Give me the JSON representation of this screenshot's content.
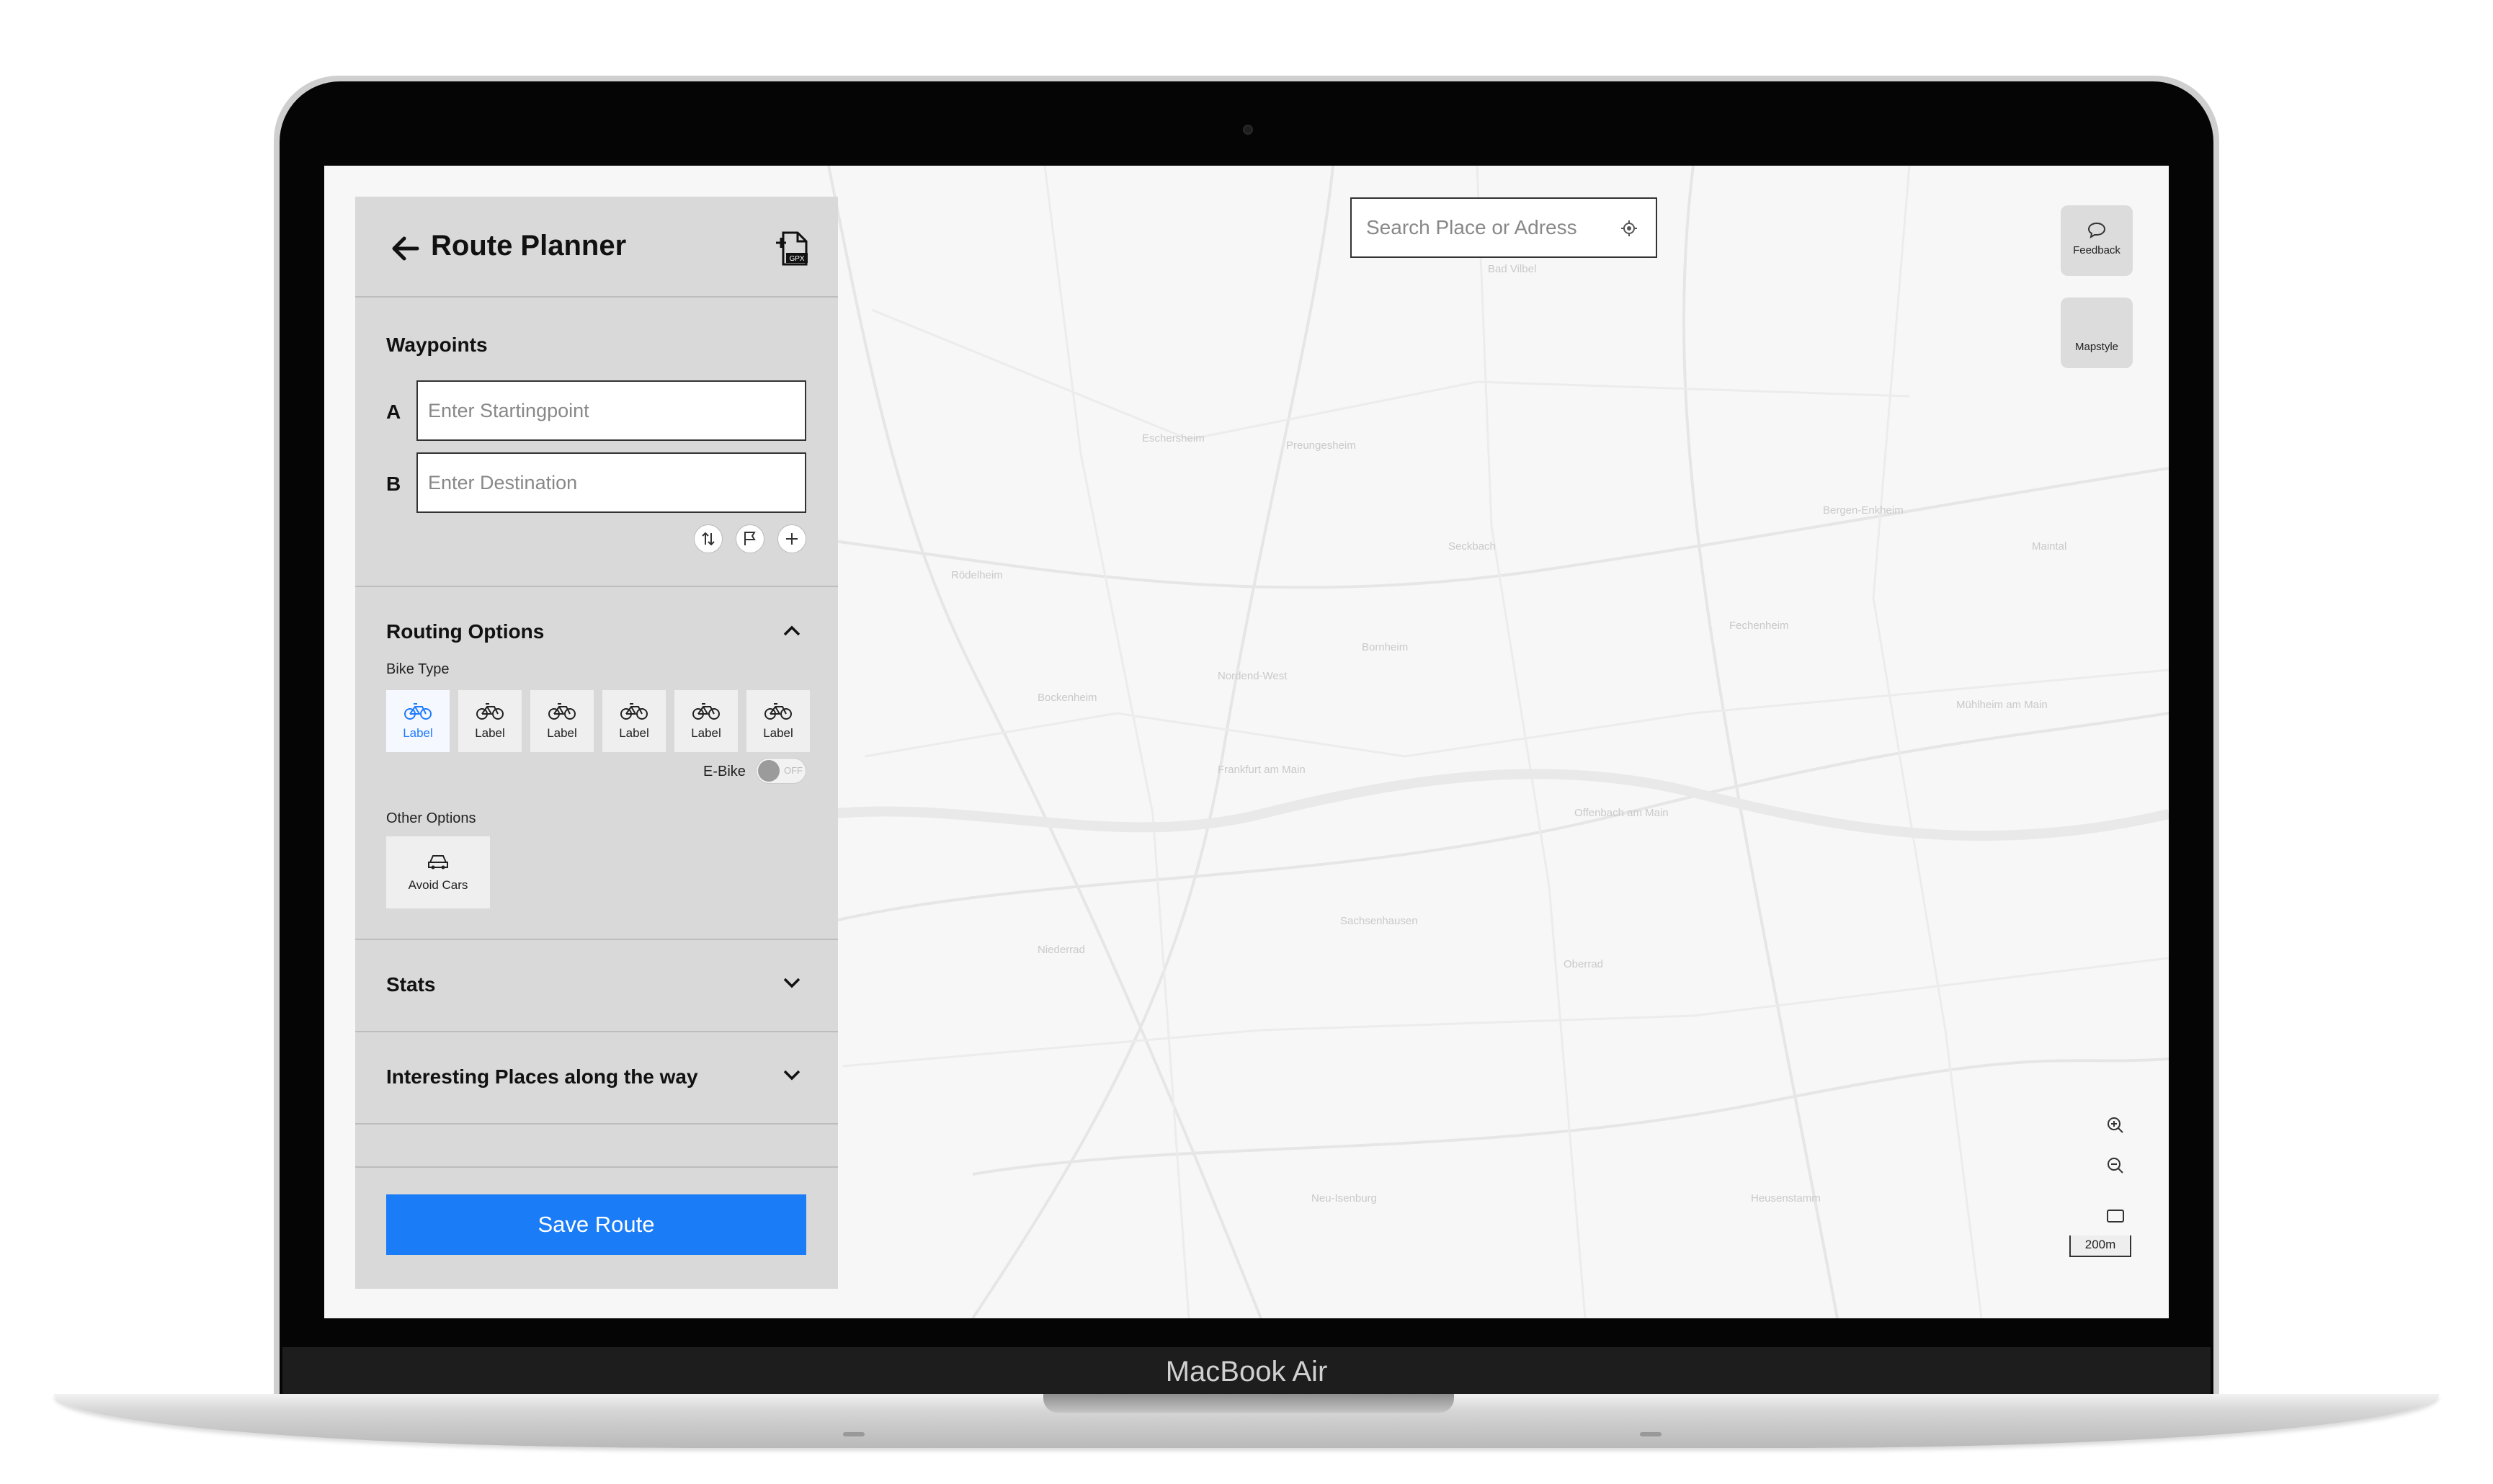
{
  "device": {
    "brand": "MacBook Air"
  },
  "panel": {
    "title": "Route Planner",
    "gpx_label": "GPX",
    "waypoints": {
      "heading": "Waypoints",
      "start_letter": "A",
      "start_placeholder": "Enter Startingpoint",
      "dest_letter": "B",
      "dest_placeholder": "Enter Destination"
    },
    "routing": {
      "heading": "Routing Options",
      "bike_type_label": "Bike Type",
      "bikes": [
        "Label",
        "Label",
        "Label",
        "Label",
        "Label",
        "Label"
      ],
      "selected_bike": 0,
      "ebike_label": "E-Bike",
      "ebike_state": "OFF",
      "other_options_label": "Other Options",
      "avoid_cars_label": "Avoid Cars"
    },
    "stats_heading": "Stats",
    "places_heading": "Interesting Places along the way",
    "save_label": "Save Route"
  },
  "map": {
    "search_placeholder": "Search Place or Adress",
    "feedback_label": "Feedback",
    "mapstyle_label": "Mapstyle",
    "scale_label": "200m",
    "place_labels": [
      "Frankfurt am Main",
      "Offenbach am Main",
      "Bad Vilbel",
      "Bergen-Enkheim",
      "Rödelheim",
      "Bockenheim",
      "Nordend-West",
      "Sachsenhausen",
      "Niederrad",
      "Neu-Isenburg",
      "Heusenstamm",
      "Mühlheim am Main",
      "Maintal",
      "Eschersheim",
      "Preungesheim",
      "Seckbach",
      "Bornheim",
      "Fechenheim",
      "Oberrad"
    ]
  },
  "colors": {
    "accent": "#1a7cf7",
    "panel_bg": "#d9d9d9",
    "map_bg": "#f7f7f7"
  }
}
